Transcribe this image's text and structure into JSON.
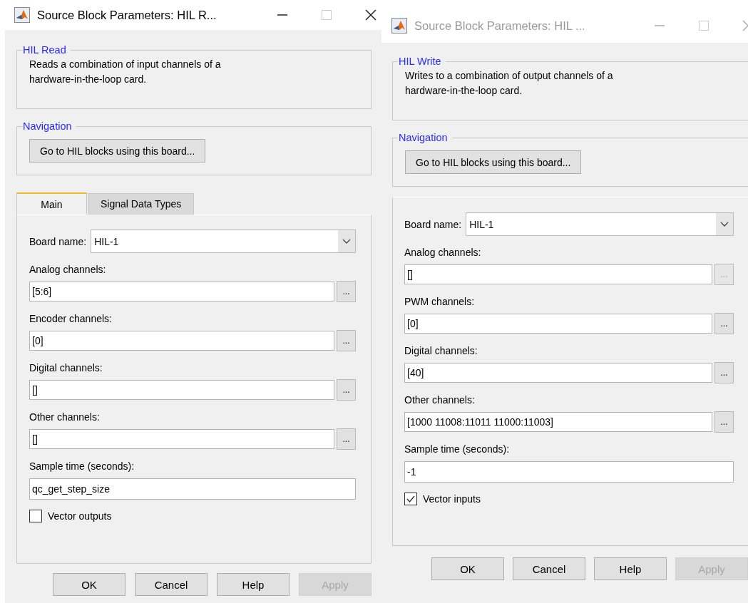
{
  "dialogs": [
    {
      "title": "Source Block Parameters: HIL R...",
      "active": true,
      "description": {
        "heading": "HIL Read",
        "text": "Reads a combination of input channels of a\nhardware-in-the-loop card."
      },
      "navigation": {
        "heading": "Navigation",
        "button": "Go to HIL blocks using this board..."
      },
      "tabs": [
        {
          "label": "Main",
          "selected": true
        },
        {
          "label": "Signal Data Types",
          "selected": false
        }
      ],
      "board": {
        "label": "Board name:",
        "value": "HIL-1"
      },
      "fields": [
        {
          "label": "Analog channels:",
          "value": "[5:6]",
          "browse": "...",
          "disabled": false
        },
        {
          "label": "Encoder channels:",
          "value": "[0]",
          "browse": "...",
          "disabled": false
        },
        {
          "label": "Digital channels:",
          "value": "[]",
          "browse": "...",
          "disabled": false
        },
        {
          "label": "Other channels:",
          "value": "[]",
          "browse": "...",
          "disabled": false
        }
      ],
      "sample": {
        "label": "Sample time (seconds):",
        "value": "qc_get_step_size"
      },
      "checkbox": {
        "label": "Vector outputs",
        "checked": false
      },
      "buttons": [
        {
          "label": "OK",
          "disabled": false
        },
        {
          "label": "Cancel",
          "disabled": false
        },
        {
          "label": "Help",
          "disabled": false
        },
        {
          "label": "Apply",
          "disabled": true
        }
      ]
    },
    {
      "title": "Source Block Parameters: HIL ...",
      "active": false,
      "description": {
        "heading": "HIL Write",
        "text": "Writes to a combination of output channels of a\nhardware-in-the-loop card."
      },
      "navigation": {
        "heading": "Navigation",
        "button": "Go to HIL blocks using this board..."
      },
      "board": {
        "label": "Board name:",
        "value": "HIL-1"
      },
      "fields": [
        {
          "label": "Analog channels:",
          "value": "[]",
          "browse": "...",
          "disabled": true
        },
        {
          "label": "PWM channels:",
          "value": "[0]",
          "browse": "...",
          "disabled": false
        },
        {
          "label": "Digital channels:",
          "value": "[40]",
          "browse": "...",
          "disabled": false
        },
        {
          "label": "Other channels:",
          "value": "[1000 11008:11011 11000:11003]",
          "browse": "...",
          "disabled": false
        }
      ],
      "sample": {
        "label": "Sample time (seconds):",
        "value": "-1"
      },
      "checkbox": {
        "label": "Vector inputs",
        "checked": true
      },
      "buttons": [
        {
          "label": "OK",
          "disabled": false
        },
        {
          "label": "Cancel",
          "disabled": false
        },
        {
          "label": "Help",
          "disabled": false
        },
        {
          "label": "Apply",
          "disabled": true
        }
      ]
    }
  ]
}
